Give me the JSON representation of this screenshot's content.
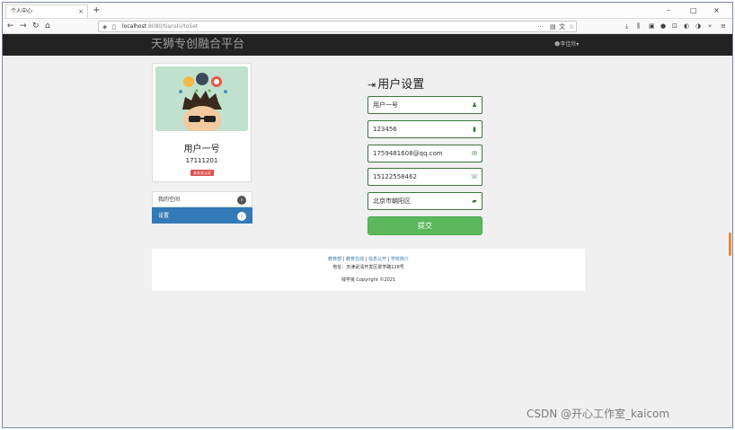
{
  "browser": {
    "tab_title": "个人中心",
    "tab_close": "×",
    "new_tab": "+",
    "window_controls": [
      "–",
      "□",
      "×"
    ],
    "url_host": "localhost",
    "url_rest": ":8080/tianshi/toSet",
    "url_actions": [
      "···",
      "☆"
    ]
  },
  "site": {
    "brand": "天狮专创融合平台",
    "user_menu": "李佳欣▾"
  },
  "profile": {
    "name": "用户一号",
    "id": "17111201",
    "badge": "未实名认证"
  },
  "menu": [
    {
      "label": "我的空间",
      "active": false
    },
    {
      "label": "设置",
      "active": true
    }
  ],
  "form": {
    "title": "用户设置",
    "username": "用户一号",
    "password": "123456",
    "email": "1759481608@qq.com",
    "phone": "15122558462",
    "address": "北京市朝阳区",
    "submit": "提交"
  },
  "footer": {
    "links": [
      "教育部",
      "教育在线",
      "信息公开",
      "学校简介"
    ],
    "address": "地址：天津武清开发区翠亨路128号",
    "copyright": "钱学良 Copyright ©2021"
  },
  "watermark": "CSDN @开心工作室_kaicom",
  "colors": {
    "header_bg": "#222222",
    "active_menu": "#337ab7",
    "submit": "#5cb85c",
    "field_border": "#3c763d",
    "badge": "#d9534f"
  },
  "icons": [
    "back-icon",
    "forward-icon",
    "reload-icon",
    "home-icon",
    "user-icon",
    "lock-icon",
    "envelope-icon",
    "phone-icon",
    "comment-icon",
    "login-icon",
    "chevron-right-icon"
  ]
}
